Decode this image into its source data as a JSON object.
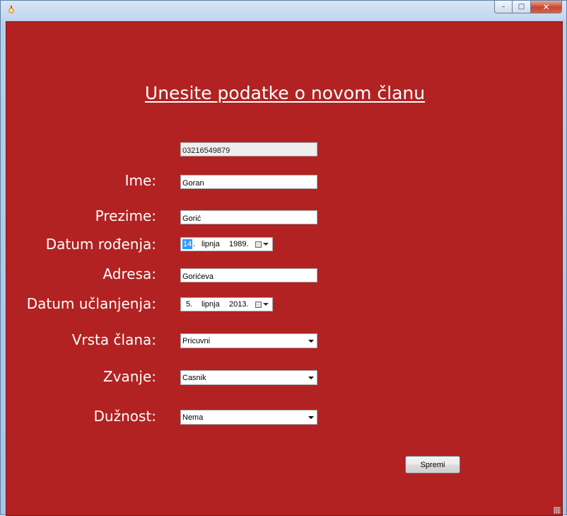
{
  "window": {
    "icon": "app-icon",
    "controls": {
      "minimize": "–",
      "maximize": "□",
      "close": "✕"
    }
  },
  "form": {
    "heading": "Unesite podatke o novom članu",
    "id_value": "03216549879",
    "ime_label": "Ime:",
    "ime_value": "Goran",
    "prezime_label": "Prezime:",
    "prezime_value": "Gorić",
    "datum_rodenja_label": "Datum rođenja:",
    "datum_rodenja": {
      "day": "14",
      "dot": ".",
      "month": "lipnja",
      "year": "1989."
    },
    "adresa_label": "Adresa:",
    "adresa_value": "Gorićeva",
    "datum_uclanjenja_label": "Datum učlanjenja:",
    "datum_uclanjenja": {
      "day": "5.",
      "month": "lipnja",
      "year": "2013."
    },
    "vrsta_clana_label": "Vrsta člana:",
    "vrsta_clana_value": "Pricuvni",
    "zvanje_label": "Zvanje:",
    "zvanje_value": "Casnik",
    "duznost_label": "Dužnost:",
    "duznost_value": "Nema",
    "save_label": "Spremi"
  },
  "colors": {
    "form_background": "#b22222",
    "label_text": "#ffffff",
    "selection": "#3399ff"
  }
}
